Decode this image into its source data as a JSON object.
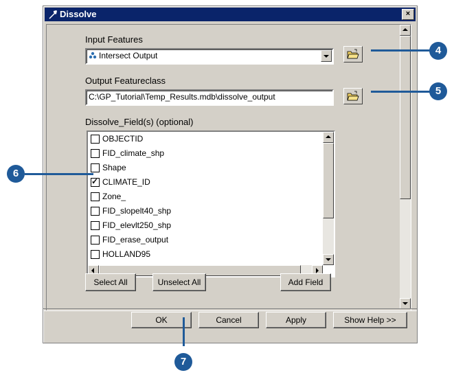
{
  "window": {
    "title": "Dissolve",
    "close_glyph": "×"
  },
  "input_features": {
    "label": "Input Features",
    "value": "Intersect Output",
    "icon": "feature-layer-icon"
  },
  "output_featureclass": {
    "label": "Output Featureclass",
    "value": "C:\\GP_Tutorial\\Temp_Results.mdb\\dissolve_output"
  },
  "dissolve_fields": {
    "label": "Dissolve_Field(s) (optional)",
    "items": [
      {
        "label": "OBJECTID",
        "checked": false
      },
      {
        "label": "FID_climate_shp",
        "checked": false
      },
      {
        "label": "Shape",
        "checked": false
      },
      {
        "label": "CLIMATE_ID",
        "checked": true
      },
      {
        "label": "Zone_",
        "checked": false
      },
      {
        "label": "FID_slopelt40_shp",
        "checked": false
      },
      {
        "label": "FID_elevlt250_shp",
        "checked": false
      },
      {
        "label": "FID_erase_output",
        "checked": false
      },
      {
        "label": "HOLLAND95",
        "checked": false
      }
    ]
  },
  "list_buttons": {
    "select_all": "Select All",
    "unselect_all": "Unselect All",
    "add_field": "Add Field"
  },
  "footer": {
    "ok": "OK",
    "cancel": "Cancel",
    "apply": "Apply",
    "show_help": "Show Help >>"
  },
  "callouts": [
    "4",
    "5",
    "6",
    "7"
  ],
  "colors": {
    "titlebar": "#0a246a",
    "callout": "#1f5a99",
    "dialog": "#d4d0c8"
  }
}
